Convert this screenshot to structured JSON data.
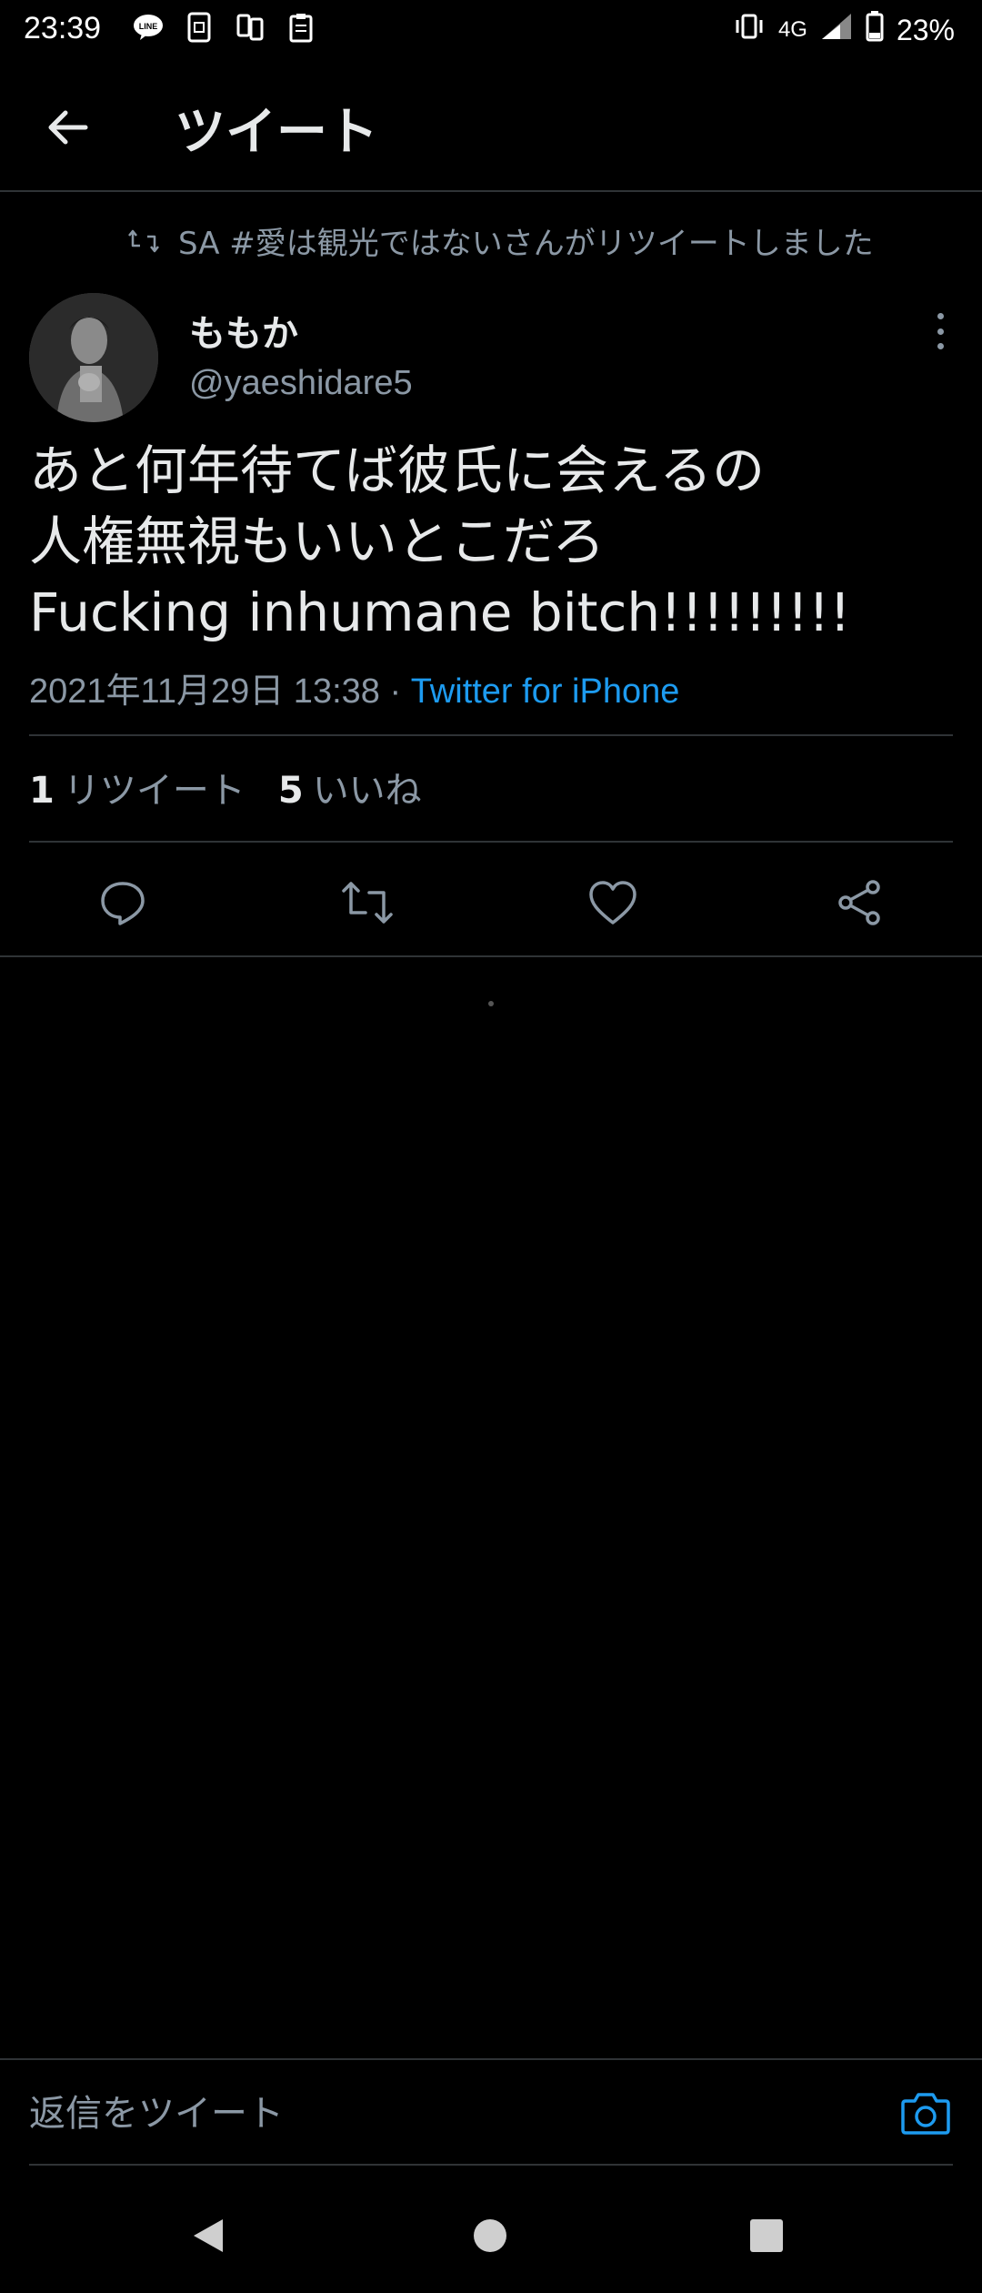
{
  "status_bar": {
    "time": "23:39",
    "network": "4G",
    "battery": "23%",
    "notification_icons": [
      "line-icon",
      "sim-icon",
      "tether-icon",
      "clipboard-icon"
    ]
  },
  "header": {
    "title": "ツイート"
  },
  "retweet_context": {
    "text": "SA #愛は観光ではないさんがリツイートしました"
  },
  "author": {
    "name": "ももか",
    "handle": "@yaeshidare5"
  },
  "tweet": {
    "text": "あと何年待てば彼氏に会えるの\n人権無視もいいとこだろ\nFucking inhumane bitch!!!!!!!!!",
    "timestamp": "2021年11月29日 13:38",
    "separator": " · ",
    "source": "Twitter for iPhone"
  },
  "stats": {
    "retweets_count": "1",
    "retweets_label": "リツイート",
    "likes_count": "5",
    "likes_label": "いいね"
  },
  "actions": [
    "reply-icon",
    "retweet-icon",
    "like-icon",
    "share-icon"
  ],
  "reply": {
    "placeholder": "返信をツイート"
  },
  "colors": {
    "background": "#000000",
    "primary_text": "#e7e9ea",
    "secondary_text": "#8b98a5",
    "accent": "#1d9bf0",
    "divider": "#2f3336"
  }
}
